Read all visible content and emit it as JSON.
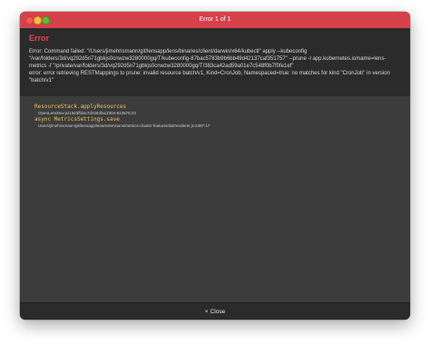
{
  "window": {
    "title": "Error 1 of 1"
  },
  "error": {
    "heading": "Error",
    "message": "Error: Command failed: \"/Users/jimehrismann/git/lensapp/lens/binaries/client/darwin/x64/kubectl\" apply --kubeconfig \"/var/folders/3d/vq292d5n71gbkjs0cnwzw3280000gq/T/kubeconfig-87bac5783b9b6bb49d42137caf351757\" --prune -l app.kubernetes.io/name=lens-metrics -f \"/private/var/folders/3d/vq292d5n71gbkjs0cnwzw3280000gq/T/383ca42ad59a01e7c548f0b7f0fe1ef\"\nerror: error retrieving RESTMappings to prune: invalid resource batch/v1, Kind=CronJob, Namespaced=true: no matches for kind \"CronJob\" in version \"batch/v1\""
  },
  "stack": [
    {
      "name": "ResourceStack.applyResources",
      "location": "OpenLensDev.js/1553ffdac7d4363fa12304-813875:23"
    },
    {
      "name": "async MetricsSettings.save",
      "location": "Users/jimehrismann/git/lensapp/lens/extensions/metrics-cluster-feature/dist/renderer.js:2487:17"
    }
  ],
  "footer": {
    "close_icon": "×",
    "close_label": "Close"
  }
}
